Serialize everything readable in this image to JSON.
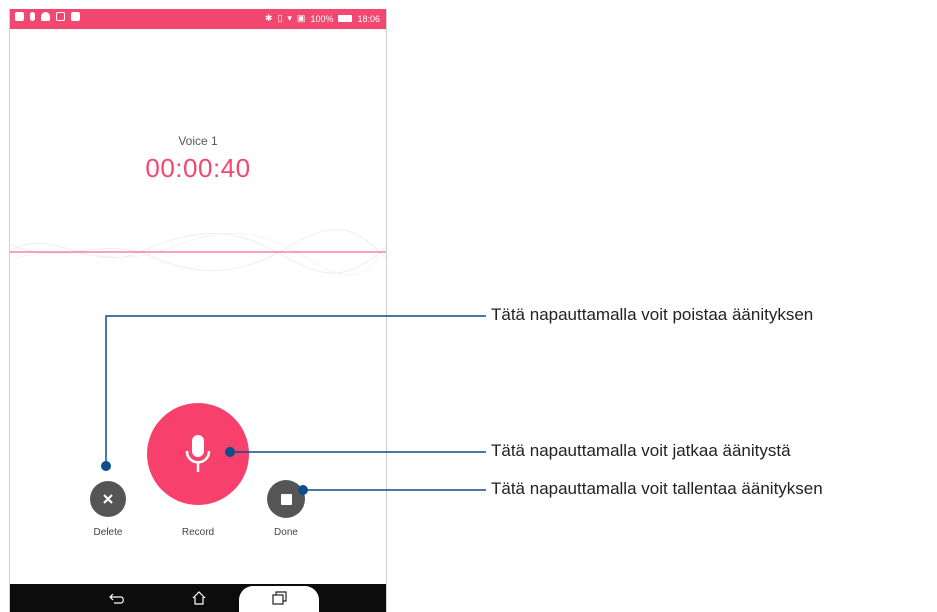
{
  "recording": {
    "name": "Voice 1",
    "elapsed": "00:00:40"
  },
  "controls": {
    "delete_label": "Delete",
    "record_label": "Record",
    "done_label": "Done"
  },
  "status_bar": {
    "battery": "100%",
    "time": "18:06",
    "icons": [
      "notification-icon",
      "mic-icon",
      "cloud-icon",
      "lock-icon",
      "camera-icon",
      "bluetooth-icon",
      "vibrate-icon",
      "wifi-icon",
      "battery-saver-icon",
      "battery-icon"
    ]
  },
  "nav_bar": {
    "icons": [
      "back-icon",
      "home-icon",
      "recents-icon"
    ]
  },
  "callouts": {
    "delete": "Tätä napauttamalla voit poistaa äänityksen",
    "record": "Tätä napauttamalla voit jatkaa äänitystä",
    "done": "Tätä napauttamalla voit tallentaa äänityksen"
  },
  "colors": {
    "accent": "#f24770",
    "control_gray": "#555555",
    "callout_line": "#0d4d8a"
  }
}
